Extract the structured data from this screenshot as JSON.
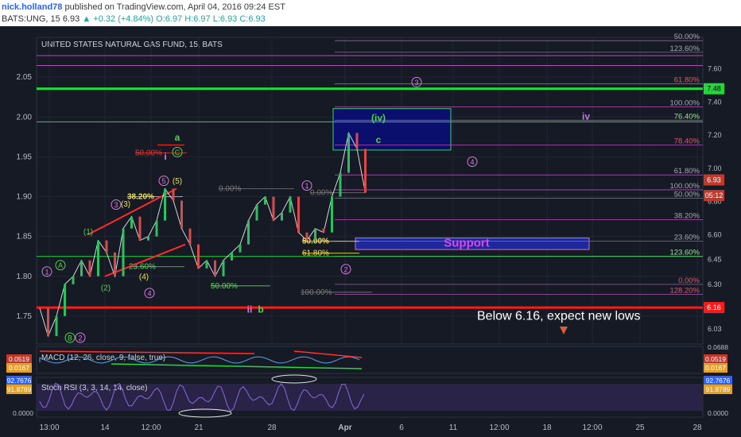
{
  "header": {
    "user": "nick.holland78",
    "published": "published on TradingView.com, April 04, 2016 09:24 EST",
    "symbol": "BATS:UNG, 15",
    "last": "6.93",
    "change": "+0.32 (+4.84%)",
    "ohlc": "O:6.97 H:6.97 L:6.93 C:6.93"
  },
  "colors": {
    "background": "#161a25",
    "green_level": "#22d83a",
    "red_level": "#ff1a1a",
    "fib_line": "#b14fb5",
    "wave_pink": "#d77de0",
    "wave_green": "#53d34d",
    "price_line": "#d6d6d6",
    "macd_red": "#ff3030",
    "macd_green": "#22d83a"
  },
  "chart_data": {
    "type": "line",
    "title": "UNITED STATES NATURAL GAS FUND, 15, BATS",
    "x_ticks": [
      "13:00",
      "14",
      "12:00",
      "21",
      "28",
      "Apr",
      "6",
      "11",
      "12:00",
      "18",
      "12:00",
      "25",
      "28"
    ],
    "left_axis": {
      "ticks": [
        "2.05",
        "2.00",
        "1.95",
        "1.90",
        "1.85",
        "1.80",
        "1.75"
      ],
      "ylim": [
        1.715,
        2.1
      ]
    },
    "right_axis": {
      "ticks": [
        "7.60",
        "7.40",
        "7.20",
        "7.00",
        "6.80",
        "6.60",
        "6.45",
        "6.30",
        "6.16",
        "6.03"
      ],
      "ylim": [
        5.94,
        7.79
      ]
    },
    "price_series": {
      "t": [
        0,
        2,
        4,
        6,
        8,
        10,
        12,
        14,
        16,
        18,
        20,
        22,
        24,
        26,
        28,
        30,
        32,
        34,
        36,
        38,
        40,
        42,
        44,
        46,
        48,
        50,
        52,
        54,
        56,
        58,
        60,
        62,
        64,
        66,
        68,
        70,
        72,
        74,
        76,
        78
      ],
      "y": [
        1.76,
        1.725,
        1.75,
        1.79,
        1.8,
        1.82,
        1.8,
        1.845,
        1.83,
        1.8,
        1.86,
        1.875,
        1.845,
        1.85,
        1.87,
        1.91,
        1.895,
        1.86,
        1.84,
        1.81,
        1.82,
        1.8,
        1.82,
        1.83,
        1.84,
        1.87,
        1.89,
        1.9,
        1.87,
        1.88,
        1.9,
        1.855,
        1.845,
        1.86,
        1.855,
        1.9,
        1.93,
        1.98,
        1.96,
        1.905
      ]
    },
    "levels": [
      {
        "name": "green-resistance",
        "value": 7.48,
        "label": "7.48"
      },
      {
        "name": "red-support",
        "value": 6.16,
        "label": "6.16"
      }
    ],
    "price_tags": [
      {
        "value": 6.93,
        "label": "6.93"
      },
      {
        "value": 6.86,
        "label": "05:12"
      }
    ],
    "fib_labels_right": [
      {
        "text": "50.00%",
        "value": 7.77
      },
      {
        "text": "123.60%",
        "value": 7.7
      },
      {
        "text": "61.80%",
        "value": 7.51
      },
      {
        "text": "100.00%",
        "value": 7.37
      },
      {
        "text": "76.40%",
        "value": 7.29
      },
      {
        "text": "78.40%",
        "value": 7.14
      },
      {
        "text": "61.80%",
        "value": 6.96
      },
      {
        "text": "100.00%",
        "value": 6.87
      },
      {
        "text": "50.00%",
        "value": 6.82
      },
      {
        "text": "38.20%",
        "value": 6.69
      },
      {
        "text": "23.60%",
        "value": 6.56
      },
      {
        "text": "123.60%",
        "value": 6.47
      },
      {
        "text": "0.00%",
        "value": 6.3
      },
      {
        "text": "128.20%",
        "value": 6.24
      }
    ],
    "fib_labels_inner": [
      {
        "text": "50.00%",
        "value": 1.955
      },
      {
        "text": "38.20%",
        "value": 1.9
      },
      {
        "text": "0.00%",
        "value": 1.91
      },
      {
        "text": "0.00%",
        "value": 1.905
      },
      {
        "text": "23.60%",
        "value": 1.812
      },
      {
        "text": "50.00%",
        "value": 1.788
      },
      {
        "text": "50.00%",
        "value": 1.844
      },
      {
        "text": "61.80%",
        "value": 1.829
      },
      {
        "text": "100.00%",
        "value": 1.78
      }
    ],
    "wave_labels": [
      "1",
      "A",
      "B",
      "2",
      "(1)",
      "(2)",
      "3",
      "(3)",
      "(4)",
      "4",
      "5",
      "(5)",
      "C",
      "i",
      "a",
      "ii",
      "b",
      "1",
      "2",
      "(iv)",
      "c",
      "3",
      "4",
      "iv"
    ],
    "boxes": {
      "iv_box_label": "(iv)",
      "support_label": "Support"
    },
    "annotations": {
      "new_lows": "Below 6.16, expect new lows"
    },
    "macd": {
      "title": "MACD (12, 26, close, 9, false, true)",
      "values": [
        "0.0519",
        "0.0167"
      ],
      "top_value": "0.0688"
    },
    "stoch": {
      "title": "Stoch RSI (3, 3, 14, 14, close)",
      "values": [
        "92.7676",
        "91.8789"
      ],
      "bottom_value": "0.0000"
    }
  }
}
